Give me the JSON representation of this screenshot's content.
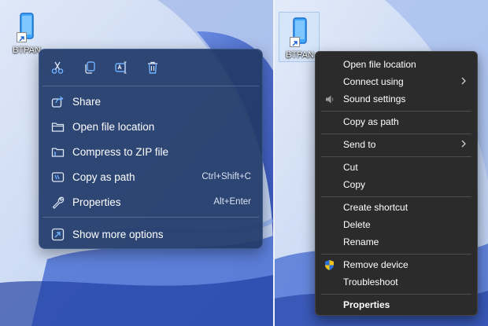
{
  "left_panel": {
    "desktop_icon": {
      "label": "BTPAN"
    },
    "quick_actions": [
      {
        "name": "cut-icon"
      },
      {
        "name": "copy-icon"
      },
      {
        "name": "rename-icon"
      },
      {
        "name": "delete-icon"
      }
    ],
    "menu_items": [
      {
        "label": "Share",
        "shortcut": "",
        "icon": "share-icon"
      },
      {
        "label": "Open file location",
        "shortcut": "",
        "icon": "folder-icon"
      },
      {
        "label": "Compress to ZIP file",
        "shortcut": "",
        "icon": "zip-folder-icon"
      },
      {
        "label": "Copy as path",
        "shortcut": "Ctrl+Shift+C",
        "icon": "copy-path-icon"
      },
      {
        "label": "Properties",
        "shortcut": "Alt+Enter",
        "icon": "wrench-icon"
      }
    ],
    "more_options": {
      "label": "Show more options",
      "icon": "expand-icon"
    }
  },
  "right_panel": {
    "desktop_icon": {
      "label": "BTPAN"
    },
    "menu_items": [
      {
        "label": "Open file location"
      },
      {
        "label": "Connect using",
        "submenu": true
      },
      {
        "label": "Sound settings",
        "icon": "speaker-icon"
      },
      {
        "label": "Copy as path"
      },
      {
        "label": "Send to",
        "submenu": true
      },
      {
        "label": "Cut"
      },
      {
        "label": "Copy"
      },
      {
        "label": "Create shortcut"
      },
      {
        "label": "Delete"
      },
      {
        "label": "Rename"
      },
      {
        "label": "Remove device",
        "icon": "shield-icon"
      },
      {
        "label": "Troubleshoot"
      },
      {
        "label": "Properties",
        "bold": true
      }
    ]
  },
  "colors": {
    "wallpaper_base": "#c7d6f3",
    "modern_menu_bg": "#213a68",
    "classic_menu_bg": "#2b2b2b",
    "icon_accent": "#6fb0ff"
  }
}
